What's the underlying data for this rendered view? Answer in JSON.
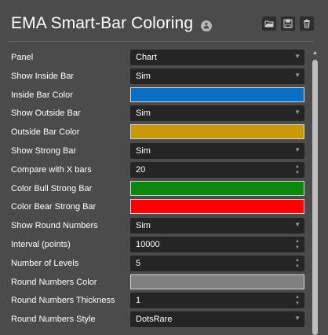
{
  "header": {
    "title": "EMA Smart-Bar Coloring",
    "icons": [
      "info-icon",
      "open-icon",
      "save-icon",
      "delete-icon"
    ]
  },
  "rows": [
    {
      "label": "Panel",
      "type": "select",
      "value": "Chart"
    },
    {
      "label": "Show Inside Bar",
      "type": "select",
      "value": "Sim"
    },
    {
      "label": "Inside Bar Color",
      "type": "color",
      "color": "#0a6fc2"
    },
    {
      "label": "Show Outside Bar",
      "type": "select",
      "value": "Sim"
    },
    {
      "label": "Outside Bar Color",
      "type": "color",
      "color": "#c8980a"
    },
    {
      "label": "Show Strong Bar",
      "type": "select",
      "value": "Sim"
    },
    {
      "label": "Compare with X bars",
      "type": "number",
      "value": "20"
    },
    {
      "label": "Color Bull Strong Bar",
      "type": "color",
      "color": "#0b870b"
    },
    {
      "label": "Color Bear Strong Bar",
      "type": "color",
      "color": "#ff0000"
    },
    {
      "label": "Show Round Numbers",
      "type": "select",
      "value": "Sim"
    },
    {
      "label": "Interval (points)",
      "type": "number",
      "value": "10000"
    },
    {
      "label": "Number of Levels",
      "type": "number",
      "value": "5"
    },
    {
      "label": "Round Numbers Color",
      "type": "color",
      "color": "#808080"
    },
    {
      "label": "Round Numbers Thickness",
      "type": "number",
      "value": "1"
    },
    {
      "label": "Round Numbers Style",
      "type": "select",
      "value": "DotsRare"
    }
  ]
}
